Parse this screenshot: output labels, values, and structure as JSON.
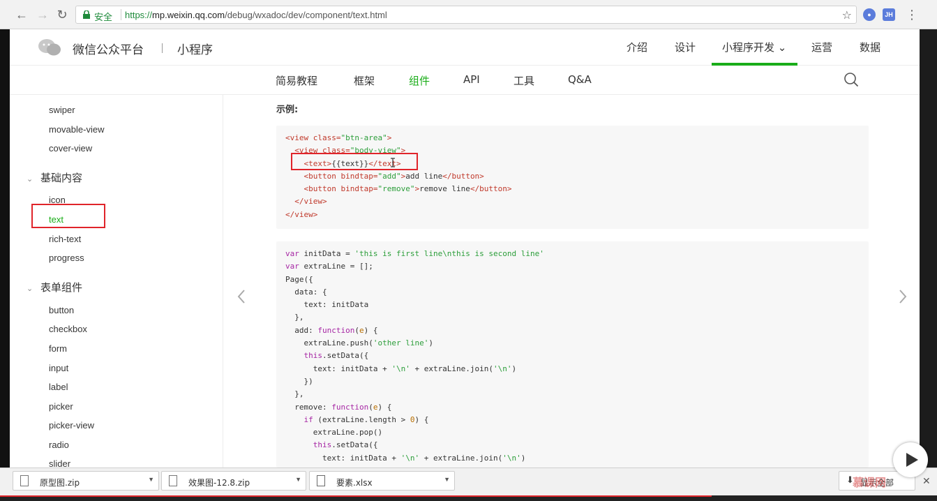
{
  "browser": {
    "secure_label": "安全",
    "url_protocol": "https://",
    "url_host": "mp.weixin.qq.com",
    "url_path": "/debug/wxadoc/dev/component/text.html",
    "ext_label": "JH"
  },
  "header": {
    "brand": "微信公众平台",
    "brand_sub": "小程序",
    "nav": [
      "介绍",
      "设计",
      "小程序开发 ⌄",
      "运营",
      "数据"
    ]
  },
  "subnav": {
    "items": [
      "简易教程",
      "框架",
      "组件",
      "API",
      "工具",
      "Q&A"
    ],
    "active_index": 2
  },
  "sidebar": {
    "group0_items": [
      "swiper",
      "movable-view",
      "cover-view"
    ],
    "group1_title": "基础内容",
    "group1_items": [
      "icon",
      "text",
      "rich-text",
      "progress"
    ],
    "group2_title": "表单组件",
    "group2_items": [
      "button",
      "checkbox",
      "form",
      "input",
      "label",
      "picker",
      "picker-view",
      "radio",
      "slider"
    ],
    "active_item": "text"
  },
  "main": {
    "section_title": "示例:"
  },
  "downloads": {
    "items": [
      "原型图.zip",
      "效果图-12.8.zip",
      "要素.xlsx"
    ],
    "show_all": "显示全部"
  },
  "watermark": "慕课网",
  "colors": {
    "accent_green": "#1aad19",
    "highlight_red": "#e0242a"
  }
}
